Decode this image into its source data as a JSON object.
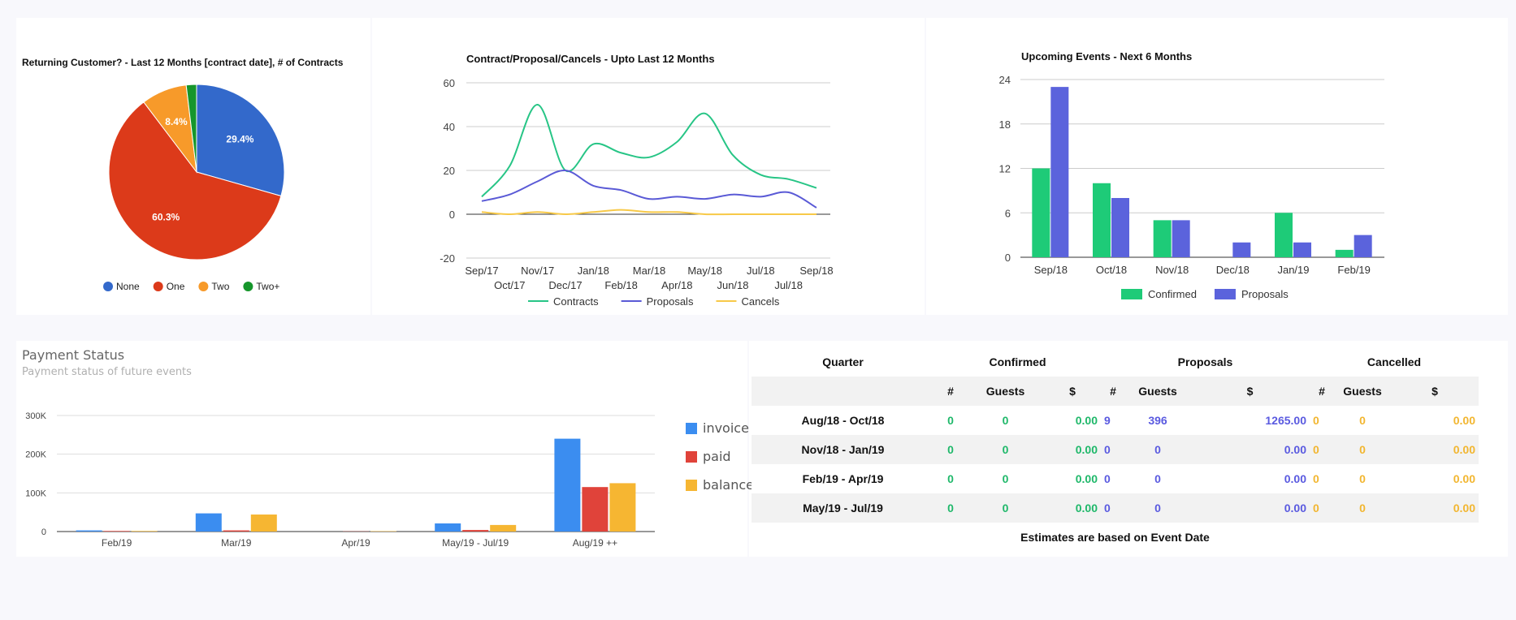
{
  "chart_data": [
    {
      "type": "pie",
      "title": "Returning Customer? - Last 12 Months [contract date], # of Contracts",
      "slices": [
        {
          "label": "None",
          "value": 29.4,
          "display": "29.4%",
          "color": "#3369cb"
        },
        {
          "label": "One",
          "value": 60.3,
          "display": "60.3%",
          "color": "#dc3a1a"
        },
        {
          "label": "Two",
          "value": 8.4,
          "display": "8.4%",
          "color": "#f79a2a"
        },
        {
          "label": "Two+",
          "value": 1.9,
          "display": "",
          "color": "#16962b"
        }
      ],
      "legend_position": "bottom"
    },
    {
      "type": "line",
      "title": "Contract/Proposal/Cancels - Upto Last 12 Months",
      "categories": [
        "Sep/17",
        "Oct/17",
        "Nov/17",
        "Dec/17",
        "Jan/18",
        "Feb/18",
        "Mar/18",
        "Apr/18",
        "May/18",
        "Jun/18",
        "Jul/18",
        "Jul/18",
        "Sep/18"
      ],
      "series": [
        {
          "name": "Contracts",
          "color": "#27c586",
          "values": [
            8,
            22,
            50,
            20,
            32,
            28,
            26,
            33,
            46,
            27,
            18,
            16,
            12
          ]
        },
        {
          "name": "Proposals",
          "color": "#5a5ad6",
          "values": [
            6,
            9,
            15,
            20,
            13,
            11,
            7,
            8,
            7,
            9,
            8,
            10,
            3
          ]
        },
        {
          "name": "Cancels",
          "color": "#f7c948",
          "values": [
            1,
            0,
            1,
            0,
            1,
            2,
            1,
            1,
            0,
            0,
            0,
            0,
            0
          ]
        }
      ],
      "y_ticks": [
        60,
        40,
        20,
        0,
        -20
      ],
      "ylim": [
        -20,
        60
      ],
      "grid": true,
      "legend_position": "bottom"
    },
    {
      "type": "bar",
      "title": "Upcoming Events - Next 6 Months",
      "categories": [
        "Sep/18",
        "Oct/18",
        "Nov/18",
        "Dec/18",
        "Jan/19",
        "Feb/19"
      ],
      "series": [
        {
          "name": "Confirmed",
          "color": "#1ecb78",
          "values": [
            12,
            10,
            5,
            0,
            6,
            1
          ]
        },
        {
          "name": "Proposals",
          "color": "#5b63dc",
          "values": [
            23,
            8,
            5,
            2,
            2,
            3
          ]
        }
      ],
      "y_ticks": [
        24,
        18,
        12,
        6,
        0
      ],
      "ylim": [
        0,
        24
      ],
      "grid": true,
      "legend_position": "bottom"
    },
    {
      "type": "bar",
      "title": "Payment Status",
      "subtitle": "Payment status of future events",
      "categories": [
        "Feb/19",
        "Mar/19",
        "Apr/19",
        "May/19 - Jul/19",
        "Aug/19 ++"
      ],
      "series": [
        {
          "name": "invoice",
          "color": "#3b8df0",
          "values": [
            3000,
            47000,
            0,
            21000,
            240000
          ]
        },
        {
          "name": "paid",
          "color": "#e0433a",
          "values": [
            1500,
            3000,
            500,
            4000,
            115000
          ]
        },
        {
          "name": "balance",
          "color": "#f6b632",
          "values": [
            1500,
            44000,
            1000,
            17000,
            125000
          ]
        }
      ],
      "y_ticks": [
        "300K",
        "200K",
        "100K",
        "0"
      ],
      "ylim": [
        0,
        300000
      ],
      "grid": true,
      "legend_position": "right"
    }
  ],
  "table": {
    "headers": {
      "quarter": "Quarter",
      "confirmed": "Confirmed",
      "proposals": "Proposals",
      "cancelled": "Cancelled"
    },
    "sub_headers": [
      "#",
      "Guests",
      "$",
      "#",
      "Guests",
      "$",
      "#",
      "Guests",
      "$"
    ],
    "rows": [
      {
        "quarter": "Aug/18 - Oct/18",
        "c_n": "0",
        "c_g": "0",
        "c_d": "0.00",
        "p_n": "9",
        "p_g": "396",
        "p_d": "1265.00",
        "x_n": "0",
        "x_g": "0",
        "x_d": "0.00"
      },
      {
        "quarter": "Nov/18 - Jan/19",
        "c_n": "0",
        "c_g": "0",
        "c_d": "0.00",
        "p_n": "0",
        "p_g": "0",
        "p_d": "0.00",
        "x_n": "0",
        "x_g": "0",
        "x_d": "0.00"
      },
      {
        "quarter": "Feb/19 - Apr/19",
        "c_n": "0",
        "c_g": "0",
        "c_d": "0.00",
        "p_n": "0",
        "p_g": "0",
        "p_d": "0.00",
        "x_n": "0",
        "x_g": "0",
        "x_d": "0.00"
      },
      {
        "quarter": "May/19 - Jul/19",
        "c_n": "0",
        "c_g": "0",
        "c_d": "0.00",
        "p_n": "0",
        "p_g": "0",
        "p_d": "0.00",
        "x_n": "0",
        "x_g": "0",
        "x_d": "0.00"
      }
    ],
    "footer": "Estimates are based on Event Date"
  }
}
